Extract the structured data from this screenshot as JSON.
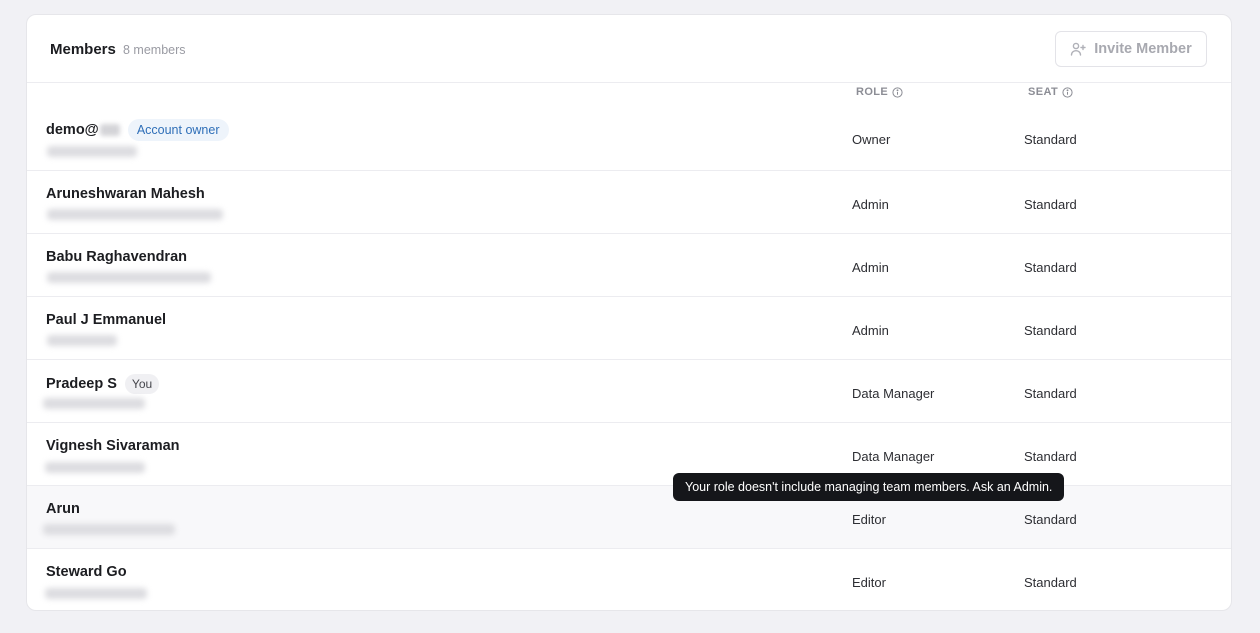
{
  "header": {
    "title": "Members",
    "count": "8 members",
    "invite_label": "Invite Member"
  },
  "columns": {
    "role": "ROLE",
    "seat": "SEAT"
  },
  "members": [
    {
      "name": "demo@",
      "badge": "Account owner",
      "role": "Owner",
      "seat": "Standard"
    },
    {
      "name": "Aruneshwaran Mahesh",
      "role": "Admin",
      "seat": "Standard"
    },
    {
      "name": "Babu Raghavendran",
      "role": "Admin",
      "seat": "Standard"
    },
    {
      "name": "Paul J Emmanuel",
      "role": "Admin",
      "seat": "Standard"
    },
    {
      "name": "Pradeep S",
      "badge": "You",
      "role": "Data Manager",
      "seat": "Standard"
    },
    {
      "name": "Vignesh Sivaraman",
      "role": "Data Manager",
      "seat": "Standard"
    },
    {
      "name": "Arun",
      "role": "Editor",
      "seat": "Standard"
    },
    {
      "name": "Steward Go",
      "role": "Editor",
      "seat": "Standard"
    }
  ],
  "tooltip": "Your role doesn't include managing team members. Ask an Admin.",
  "icons": {
    "invite": "user-plus-icon",
    "info": "info-icon"
  },
  "colors": {
    "owner_badge_text": "#2f6fb8",
    "tooltip_bg": "#15161a"
  }
}
